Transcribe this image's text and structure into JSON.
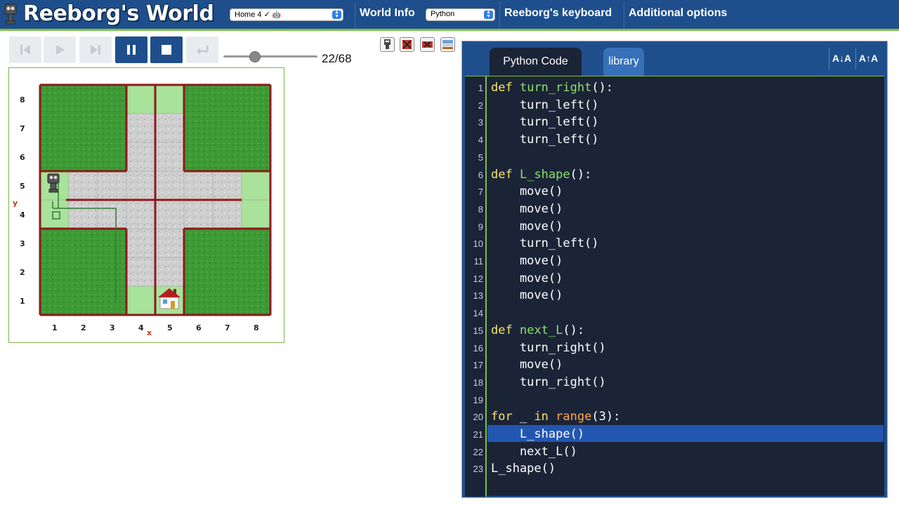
{
  "app": {
    "title": "Reeborg's World"
  },
  "header": {
    "world_select": "Home 4 ✓",
    "world_info": "World Info",
    "language_select": "Python",
    "keyboard": "Reeborg's keyboard",
    "additional_options": "Additional options"
  },
  "controls": {
    "step_counter": "22/68",
    "slider_level": 0.33
  },
  "world": {
    "y_axis_label": "y",
    "x_axis_label": "x",
    "y_ticks": [
      "8",
      "7",
      "6",
      "5",
      "4",
      "3",
      "2",
      "1"
    ],
    "x_ticks": [
      "1",
      "2",
      "3",
      "4",
      "5",
      "6",
      "7",
      "8"
    ]
  },
  "editor": {
    "tabs": [
      {
        "label": "Python Code",
        "active": true
      },
      {
        "label": "library",
        "active": false
      }
    ],
    "font_decrease": "A↓A",
    "font_increase": "A↑A",
    "active_line": 21,
    "lines": [
      {
        "n": "1",
        "text": "def turn_right():"
      },
      {
        "n": "2",
        "text": "    turn_left()"
      },
      {
        "n": "3",
        "text": "    turn_left()"
      },
      {
        "n": "4",
        "text": "    turn_left()"
      },
      {
        "n": "5",
        "text": ""
      },
      {
        "n": "6",
        "text": "def L_shape():"
      },
      {
        "n": "7",
        "text": "    move()"
      },
      {
        "n": "8",
        "text": "    move()"
      },
      {
        "n": "9",
        "text": "    move()"
      },
      {
        "n": "10",
        "text": "    turn_left()"
      },
      {
        "n": "11",
        "text": "    move()"
      },
      {
        "n": "12",
        "text": "    move()"
      },
      {
        "n": "13",
        "text": "    move()"
      },
      {
        "n": "14",
        "text": ""
      },
      {
        "n": "15",
        "text": "def next_L():"
      },
      {
        "n": "16",
        "text": "    turn_right()"
      },
      {
        "n": "17",
        "text": "    move()"
      },
      {
        "n": "18",
        "text": "    turn_right()"
      },
      {
        "n": "19",
        "text": ""
      },
      {
        "n": "20",
        "text": "for _ in range(3):"
      },
      {
        "n": "21",
        "text": "    L_shape()"
      },
      {
        "n": "22",
        "text": "    next_L()"
      },
      {
        "n": "23",
        "text": "L_shape()"
      }
    ]
  },
  "colors": {
    "header_bg": "#1e4f8c",
    "accent_green": "#7fc141",
    "editor_bg": "#1b2437",
    "keyword": "#f4e56c",
    "function_name": "#8ee06e",
    "builtin": "#ffa84a",
    "wall": "#8b1a1a"
  }
}
